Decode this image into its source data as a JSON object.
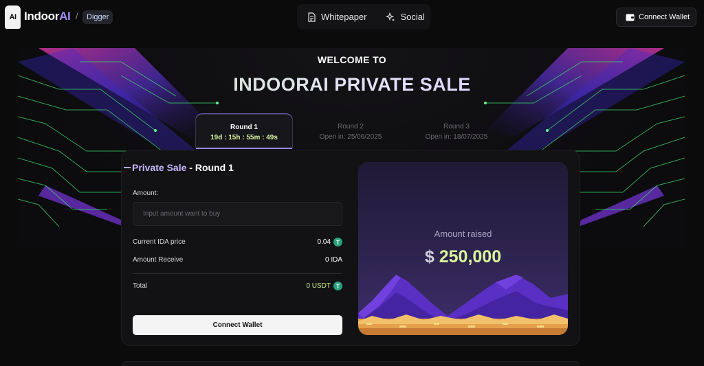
{
  "header": {
    "logo_mark": "AI",
    "brand_main": "Indoor",
    "brand_accent": "AI",
    "separator": "/",
    "tag": "Digger",
    "nav": [
      {
        "label": "Whitepaper",
        "icon": "document-icon"
      },
      {
        "label": "Social",
        "icon": "sparkles-icon"
      }
    ],
    "connect_wallet": "Connect Wallet"
  },
  "hero": {
    "welcome": "WELCOME TO",
    "title": "INDOORAI PRIVATE SALE"
  },
  "tabs": [
    {
      "label": "Round 1",
      "sub": "19d : 15h : 55m : 49s",
      "active": true
    },
    {
      "label": "Round 2",
      "sub": "Open in: 25/06/2025",
      "active": false
    },
    {
      "label": "Round 3",
      "sub": "Open in: 18/07/2025",
      "active": false
    }
  ],
  "sale": {
    "title_prefix": "Private Sale",
    "title_rest": " - Round 1",
    "amount_label": "Amount:",
    "amount_placeholder": "Input amount want to buy",
    "price_label": "Current IDA price",
    "price_value": "0.04",
    "receive_label": "Amount Receive",
    "receive_value": "0 IDA",
    "total_label": "Total",
    "total_value": "0 USDT",
    "button": "Connect Wallet",
    "token_symbol": "T"
  },
  "raised": {
    "label": "Amount raised",
    "currency": "$",
    "value": "250,000"
  },
  "colors": {
    "accent_purple": "#a78bfa",
    "accent_green": "#d9f59a",
    "tether_green": "#26a17b"
  }
}
